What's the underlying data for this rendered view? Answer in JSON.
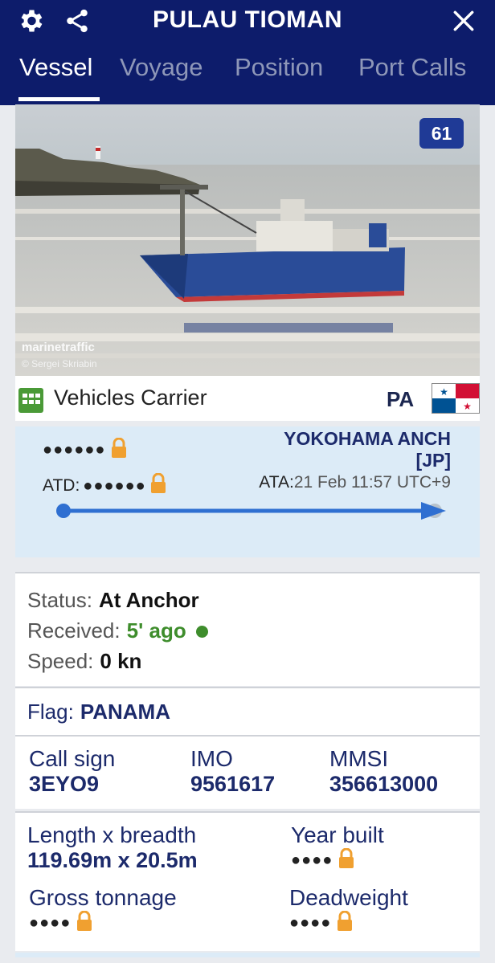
{
  "header": {
    "title": "PULAU TIOMAN",
    "settings_icon": "gear-icon",
    "share_icon": "share-icon",
    "close_icon": "close-icon",
    "tabs": [
      {
        "label": "Vessel",
        "active": true
      },
      {
        "label": "Voyage",
        "active": false
      },
      {
        "label": "Position",
        "active": false
      },
      {
        "label": "Port Calls",
        "active": false
      }
    ]
  },
  "photo": {
    "badge": "61",
    "watermark": "marinetraffic",
    "credit": "© Sergei Skriabin",
    "hull_name": "PULAU TIOMAN"
  },
  "vessel_type": {
    "label": "Vehicles Carrier",
    "flag_code": "PA"
  },
  "voyage": {
    "departure": "●●●●●●",
    "destination": "YOKOHAMA ANCH",
    "destination_country": "[JP]",
    "atd_label": "ATD:",
    "atd_value": "●●●●●●",
    "ata_label": "ATA:",
    "ata_value": "21 Feb 11:57 UTC+9"
  },
  "status": {
    "status_label": "Status:",
    "status_value": "At Anchor",
    "received_label": "Received:",
    "received_value": "5' ago",
    "speed_label": "Speed:",
    "speed_value": "0 kn"
  },
  "flag": {
    "label": "Flag:",
    "value": "PANAMA"
  },
  "ids": {
    "callsign_label": "Call sign",
    "callsign_value": "3EYO9",
    "imo_label": "IMO",
    "imo_value": "9561617",
    "mmsi_label": "MMSI",
    "mmsi_value": "356613000"
  },
  "dimensions": {
    "length_label": "Length x breadth",
    "length_value": "119.69m x 20.5m",
    "year_label": "Year built",
    "year_value": "●●●●",
    "gross_label": "Gross tonnage",
    "gross_value": "●●●●",
    "deadweight_label": "Deadweight",
    "deadweight_value": "●●●●"
  },
  "colors": {
    "header_bg": "#0d1c6b",
    "accent_blue": "#2f6fd1",
    "lock_orange": "#f0a030",
    "received_green": "#3e8d2c"
  }
}
